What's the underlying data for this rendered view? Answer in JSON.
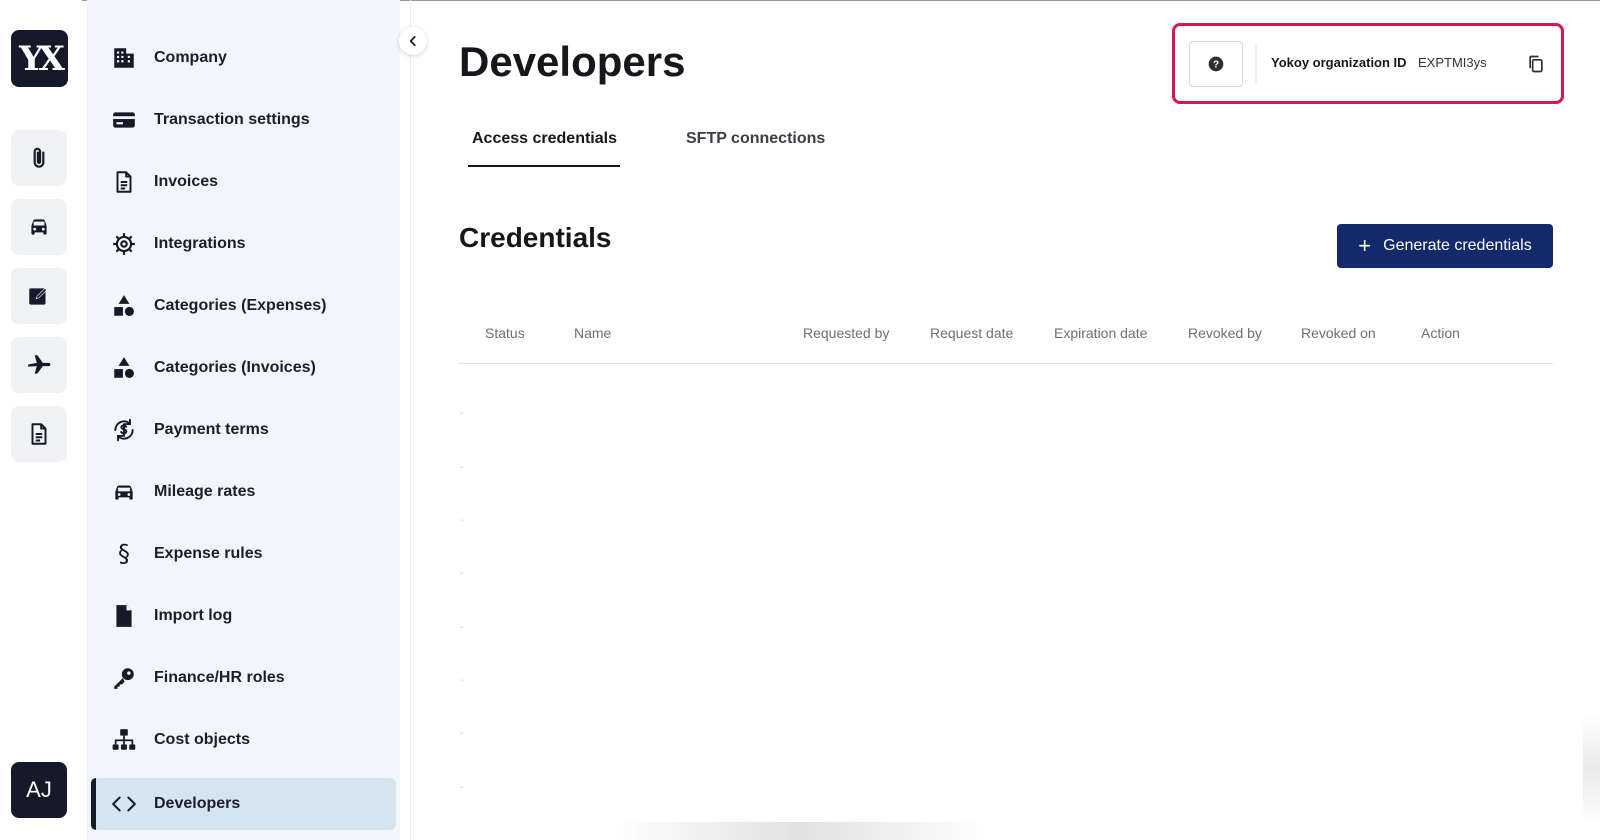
{
  "rail": {
    "logo_text": "YX",
    "avatar_initials": "AJ",
    "items": [
      {
        "icon": "paperclip-icon"
      },
      {
        "icon": "car-icon"
      },
      {
        "icon": "edit-icon"
      },
      {
        "icon": "airplane-icon"
      },
      {
        "icon": "document-icon"
      }
    ]
  },
  "sidebar": {
    "items": [
      {
        "label": "Company",
        "icon": "building-icon"
      },
      {
        "label": "Transaction settings",
        "icon": "credit-card-icon"
      },
      {
        "label": "Invoices",
        "icon": "invoice-icon"
      },
      {
        "label": "Integrations",
        "icon": "gear-icon"
      },
      {
        "label": "Categories (Expenses)",
        "icon": "shapes-icon"
      },
      {
        "label": "Categories (Invoices)",
        "icon": "shapes-icon"
      },
      {
        "label": "Payment terms",
        "icon": "currency-cycle-icon"
      },
      {
        "label": "Mileage rates",
        "icon": "car-icon"
      },
      {
        "label": "Expense rules",
        "icon": "section-icon"
      },
      {
        "label": "Import log",
        "icon": "file-icon"
      },
      {
        "label": "Finance/HR roles",
        "icon": "key-icon"
      },
      {
        "label": "Cost objects",
        "icon": "hierarchy-icon"
      },
      {
        "label": "Developers",
        "icon": "code-icon",
        "active": true
      }
    ]
  },
  "main": {
    "title": "Developers",
    "org": {
      "label": "Yokoy organization ID",
      "value": "EXPTMI3ys"
    },
    "tabs": [
      {
        "label": "Access credentials",
        "active": true
      },
      {
        "label": "SFTP connections",
        "active": false
      }
    ],
    "section_title": "Credentials",
    "generate_button": "Generate credentials",
    "table": {
      "columns": [
        "Status",
        "Name",
        "Requested by",
        "Request date",
        "Expiration date",
        "Revoked by",
        "Revoked on",
        "Action"
      ],
      "placeholder_rows": [
        "-",
        "-",
        "-",
        "-",
        "-",
        "-",
        "-",
        "-"
      ]
    }
  },
  "colors": {
    "brand_dark": "#141a29",
    "primary_button": "#13296b",
    "highlight": "#d21a4e",
    "sidebar_bg": "#f2f6fa",
    "active_item_bg": "#d6e4f0"
  }
}
